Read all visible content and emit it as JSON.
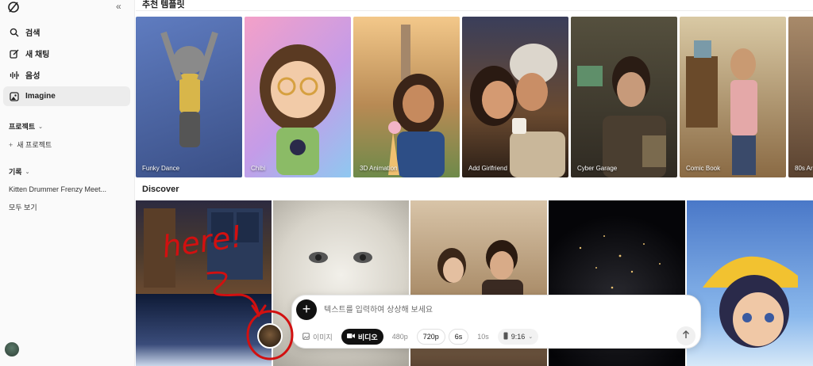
{
  "sidebar": {
    "collapse_glyph": "«",
    "nav": [
      {
        "label": "검색",
        "icon": "search-icon"
      },
      {
        "label": "새 채팅",
        "icon": "edit-icon"
      },
      {
        "label": "음성",
        "icon": "waveform-icon"
      },
      {
        "label": "Imagine",
        "icon": "imagine-icon"
      }
    ],
    "projects_header": "프로젝트",
    "new_project": "새 프로젝트",
    "history_header": "기록",
    "history_items": [
      "Kitten Drummer Frenzy Meet..."
    ],
    "see_all": "모두 보기"
  },
  "main": {
    "templates_title": "추천 템플릿",
    "discover_title": "Discover",
    "templates": [
      {
        "label": "Funky Dance",
        "bg": "#4e6aa8"
      },
      {
        "label": "Chibi",
        "bg": "#d98fcf"
      },
      {
        "label": "3D Animation",
        "bg": "#c08a4a"
      },
      {
        "label": "Add Girlfriend",
        "bg": "#4a3a2e"
      },
      {
        "label": "Cyber Garage",
        "bg": "#3f3a32"
      },
      {
        "label": "Comic Book",
        "bg": "#b99560"
      },
      {
        "label": "80s Ar",
        "bg": "#8c6a4a"
      }
    ]
  },
  "composer": {
    "placeholder": "텍스트를 입력하여 상상해 보세요",
    "image_label": "이미지",
    "video_label": "비디오",
    "res_480": "480p",
    "res_720": "720p",
    "dur_6": "6s",
    "dur_10": "10s",
    "aspect": "9:16"
  },
  "annotation": {
    "text": "here!",
    "color": "#d21010"
  }
}
